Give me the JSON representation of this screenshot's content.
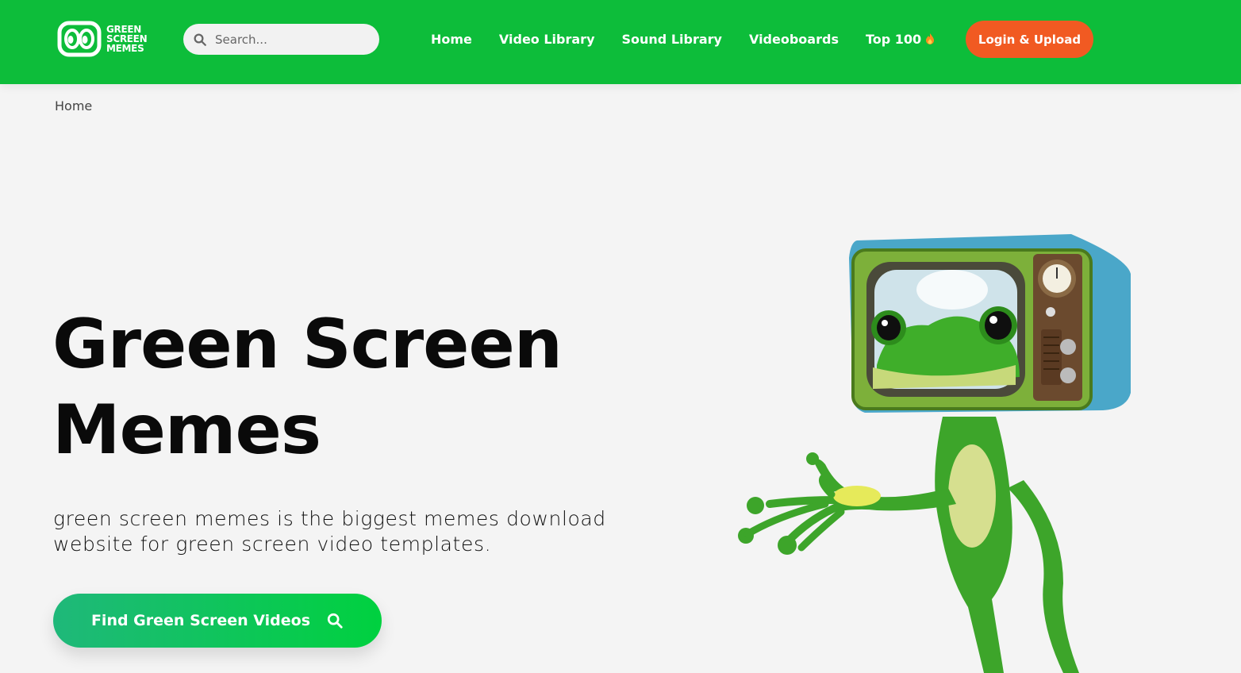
{
  "brand": {
    "logo_lines": [
      "GREEN",
      "SCREEN",
      "MEMES"
    ],
    "primary_color": "#0dbd3a",
    "accent_color": "#f15a22"
  },
  "search": {
    "placeholder": "Search...",
    "icon": "search-icon"
  },
  "nav": {
    "items": [
      {
        "label": "Home"
      },
      {
        "label": "Video Library"
      },
      {
        "label": "Sound Library"
      },
      {
        "label": "Videoboards"
      },
      {
        "label": "Top 100",
        "icon": "fire-icon"
      }
    ]
  },
  "login": {
    "label": "Login & Upload"
  },
  "breadcrumb": {
    "label": "Home"
  },
  "hero": {
    "title_line1": "Green Screen",
    "title_line2": "Memes",
    "subtitle_line1": "green screen memes is the biggest memes download",
    "subtitle_line2": "website for green screen video templates.",
    "cta_label": "Find Green Screen Videos",
    "cta_icon": "search-icon",
    "illustration": "frog-tv-head-illustration"
  }
}
